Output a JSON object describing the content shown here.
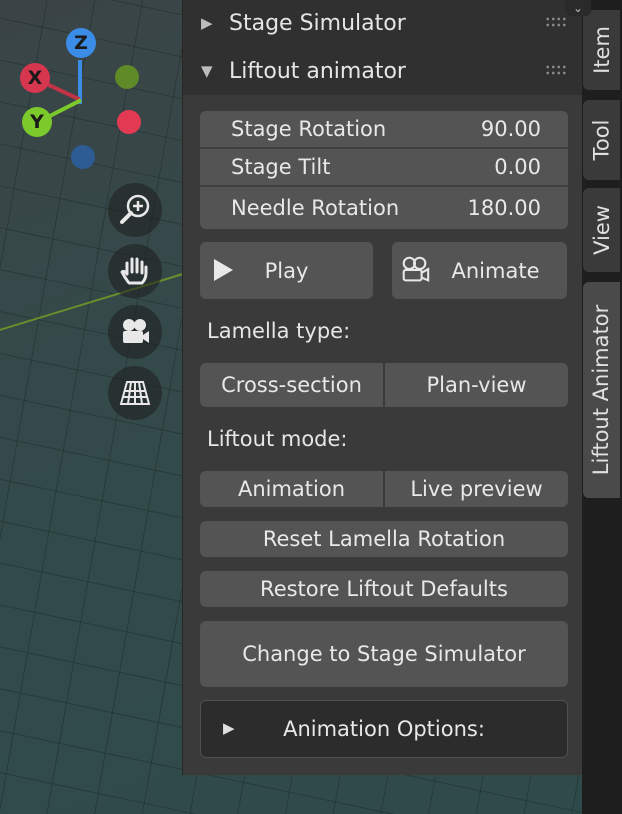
{
  "gizmo": {
    "z_label": "Z",
    "x_label": "X",
    "y_label": "Y",
    "colors": {
      "z": "#3b8ce6",
      "x": "#d6364e",
      "y": "#7cc92b",
      "x_neg": "#9a3443",
      "y_neg": "#5e8a27",
      "z_neg": "#2d5b93"
    }
  },
  "nav_icons": [
    "zoom-icon",
    "hand-pan-icon",
    "camera-icon",
    "grid-perspective-icon"
  ],
  "panel": {
    "stage_simulator_title": "Stage Simulator",
    "liftout_animator_title": "Liftout animator",
    "fields": [
      {
        "label": "Stage Rotation",
        "value": "90.00"
      },
      {
        "label": "Stage Tilt",
        "value": "0.00"
      },
      {
        "label": "Needle Rotation",
        "value": "180.00"
      }
    ],
    "play_label": "Play",
    "animate_label": "Animate",
    "lamella_type_label": "Lamella type:",
    "lamella_options": [
      "Cross-section",
      "Plan-view"
    ],
    "liftout_mode_label": "Liftout mode:",
    "mode_options": [
      "Animation",
      "Live preview"
    ],
    "reset_label": "Reset Lamella Rotation",
    "restore_label": "Restore Liftout Defaults",
    "change_label": "Change to Stage Simulator",
    "animation_options_label": "Animation Options:"
  },
  "tabs": [
    "Item",
    "Tool",
    "View",
    "Liftout Animator"
  ]
}
